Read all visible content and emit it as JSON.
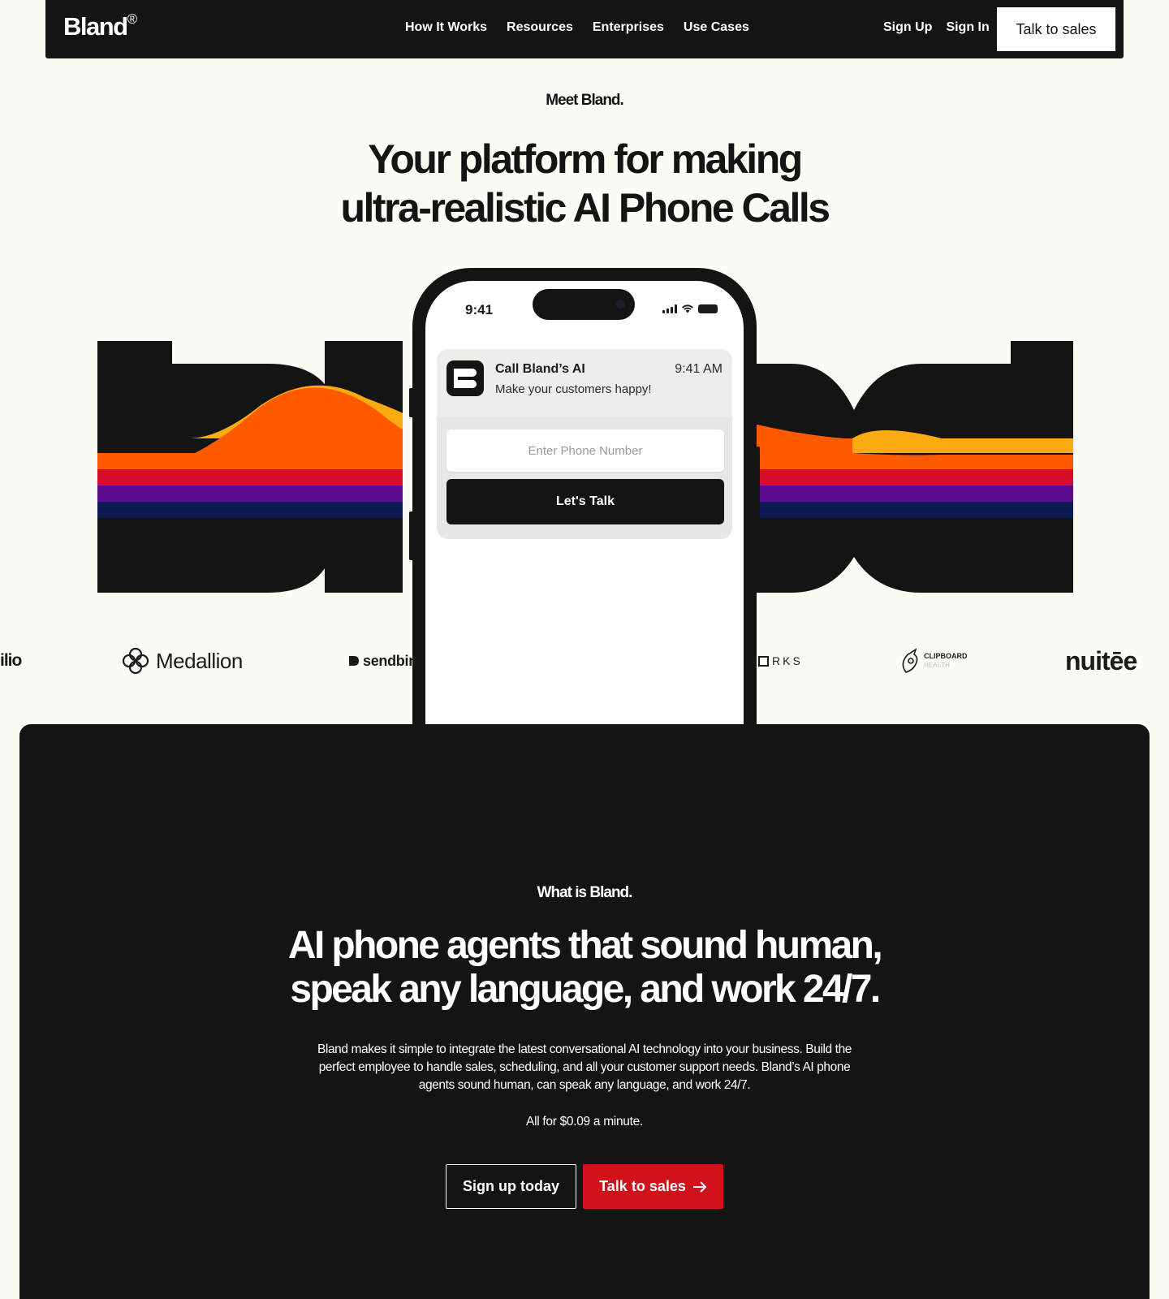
{
  "nav": {
    "logo": "Bland",
    "logo_mark": "®",
    "links": [
      "How It Works",
      "Resources",
      "Enterprises",
      "Use Cases"
    ],
    "sign_up": "Sign Up",
    "sign_in": "Sign In",
    "cta": "Talk to sales"
  },
  "hero": {
    "eyebrow": "Meet Bland.",
    "title_line1": "Your platform for making",
    "title_line2": "ultra-realistic AI Phone Calls"
  },
  "phone": {
    "status_time": "9:41",
    "notification": {
      "title": "Call Bland’s AI",
      "time": "9:41 AM",
      "message": "Make your customers happy!"
    },
    "input_placeholder": "Enter Phone Number",
    "button": "Let's Talk"
  },
  "logos": {
    "items": [
      "ilio",
      "Medallion",
      "sendbir",
      "RKS",
      "CLIPBOARD",
      "HEALTH",
      "nuitēe"
    ],
    "icons": [
      "medallion-logo-icon",
      "sendbird-logo-icon",
      "clipboard-health-logo-icon"
    ]
  },
  "about": {
    "eyebrow": "What is Bland.",
    "title_line1": "AI phone agents that sound human,",
    "title_line2": "speak any language, and work 24/7.",
    "body": "Bland makes it simple to integrate the latest conversational AI technology into your business. Build the perfect employee to handle sales, scheduling, and all your customer support needs. Bland’s AI phone agents sound human, can speak any language, and work 24/7.",
    "price": "All for $0.09 a minute.",
    "primary_button": "Sign up today",
    "secondary_button": "Talk to sales"
  },
  "colors": {
    "ink": "#141414",
    "background": "#fcfcf7",
    "accent_red": "#d0121a",
    "band_orange": "#ff5a00",
    "band_amber": "#fcab10",
    "band_red": "#d60e2a",
    "band_purple": "#5b0a8f",
    "band_navy": "#0c1c52"
  }
}
